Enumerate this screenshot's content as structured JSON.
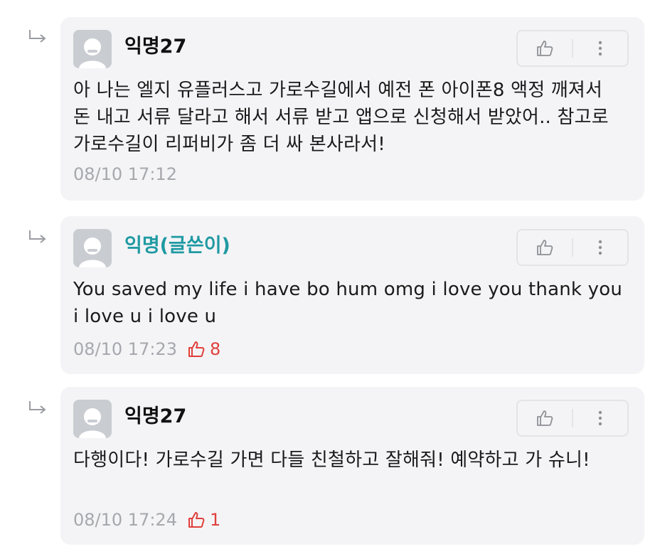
{
  "comments": [
    {
      "author": "익명27",
      "is_op": false,
      "body": "아 나는 엘지 유플러스고 가로수길에서 예전 폰 아이폰8 액정 깨져서 돈 내고 서류 달라고 해서 서류 받고 앱으로 신청해서 받았어.. 참고로 가로수길이 리퍼비가 좀 더 싸 본사라서!",
      "timestamp": "08/10 17:12",
      "likes": ""
    },
    {
      "author": "익명(글쓴이)",
      "is_op": true,
      "body": "You saved my life i have bo hum omg i love you thank you i love u i love u",
      "timestamp": "08/10 17:23",
      "likes": "8"
    },
    {
      "author": "익명27",
      "is_op": false,
      "body": "다행이다! 가로수길 가면 다들 친철하고 잘해줘! 예약하고 가 슈니!",
      "timestamp": "08/10 17:24",
      "likes": "1"
    }
  ],
  "colors": {
    "op_name": "#1f9aa3",
    "like": "#e0403c",
    "meta": "#a6a8ae",
    "card_bg": "#f4f4f6"
  },
  "icons": {
    "reply": "reply-arrow-icon",
    "like": "thumbs-up-icon",
    "more": "more-vertical-icon",
    "avatar": "default-avatar-icon"
  }
}
